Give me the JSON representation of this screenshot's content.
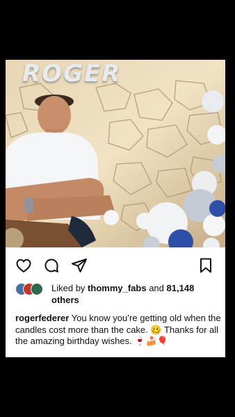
{
  "post": {
    "balloon_text": "ROGER",
    "actions": {
      "like_icon": "heart-outline-icon",
      "comment_icon": "comment-bubble-icon",
      "share_icon": "paper-plane-icon",
      "save_icon": "bookmark-outline-icon"
    },
    "likes": {
      "prefix": "Liked by",
      "user": "thommy_fabs",
      "middle": "and",
      "count": "81,148",
      "suffix": "others"
    },
    "caption": {
      "username": "rogerfederer",
      "line1": "You know you’re getting old when the candles cost more than the cake.",
      "emoji1": "🥴",
      "line2": "Thanks for all the amazing birthday wishes.",
      "emoji2": "🍷🍰🎈"
    }
  },
  "colors": {
    "background": "#000000",
    "card": "#ffffff",
    "text": "#111111",
    "balloon_blue": "#2f4ea8",
    "balloon_white": "#f2f3f5",
    "balloon_silver": "#c5ccd6"
  }
}
